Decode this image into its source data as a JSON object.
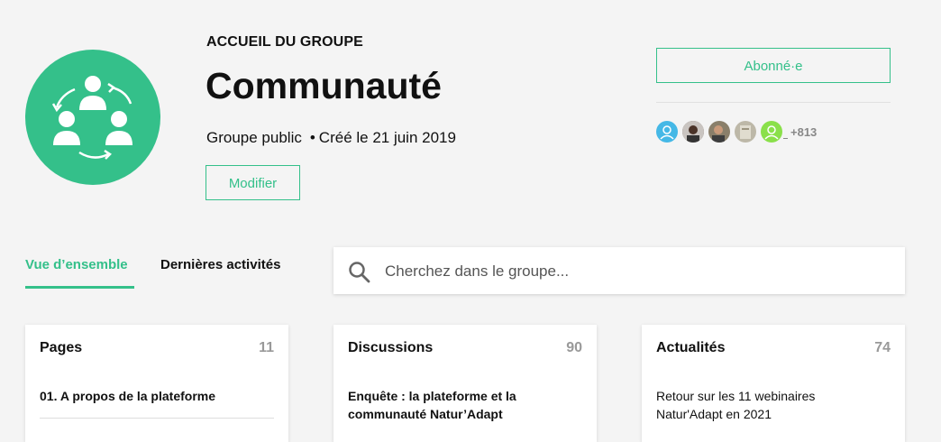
{
  "header": {
    "kicker": "ACCUEIL DU GROUPE",
    "title": "Communauté",
    "visibility": "Groupe public",
    "created": "Créé le 21 juin 2019",
    "modify_label": "Modifier",
    "logo_icon": "community-people-icon",
    "accent_color": "#34c08a"
  },
  "membership": {
    "subscribe_label": "Abonné·e",
    "extra_members": "+813",
    "avatars": [
      "avatar-default-blue",
      "avatar-photo-1",
      "avatar-photo-2",
      "avatar-photo-3",
      "avatar-default-green"
    ]
  },
  "tabs": [
    {
      "label": "Vue d’ensemble",
      "active": true
    },
    {
      "label": "Dernières activités",
      "active": false
    }
  ],
  "search": {
    "placeholder": "Cherchez dans le groupe...",
    "icon": "search-icon"
  },
  "cards": [
    {
      "title": "Pages",
      "count": "11",
      "item": "01. A propos de la plateforme"
    },
    {
      "title": "Discussions",
      "count": "90",
      "item": "Enquête : la plateforme et la communauté Natur’Adapt"
    },
    {
      "title": "Actualités",
      "count": "74",
      "item": "Retour sur les 11 webinaires Natur'Adapt en 2021"
    }
  ]
}
